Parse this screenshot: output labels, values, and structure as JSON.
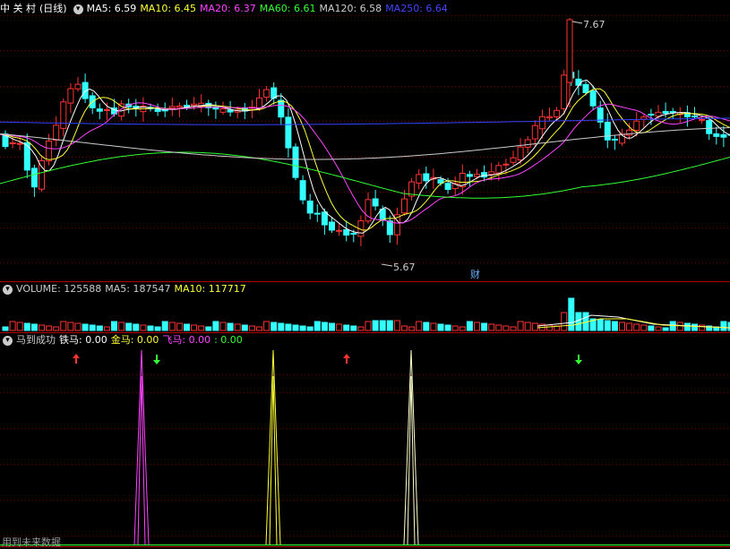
{
  "stock": {
    "name": "中 关 村",
    "period": "(日线)"
  },
  "main_ma": [
    {
      "label": "MA5: 6.59",
      "color": "#ffffff"
    },
    {
      "label": "MA10: 6.45",
      "color": "#ffff33"
    },
    {
      "label": "MA20: 6.37",
      "color": "#ff44ff"
    },
    {
      "label": "MA60: 6.61",
      "color": "#33ff33"
    },
    {
      "label": "MA120: 6.58",
      "color": "#cccccc"
    },
    {
      "label": "MA250: 6.64",
      "color": "#4444ff"
    }
  ],
  "price_high_label": "7.67",
  "price_low_label": "5.67",
  "cai_marker": "财",
  "volume": {
    "labels": [
      {
        "label": "VOLUME: 125588",
        "color": "#cccccc"
      },
      {
        "label": "MA5: 187547",
        "color": "#cccccc"
      },
      {
        "label": "MA10: 117717",
        "color": "#ffff33"
      }
    ]
  },
  "indicator": {
    "labels": [
      {
        "label": "马到成功",
        "color": "#cccccc"
      },
      {
        "label": "铁马: 0.00",
        "color": "#ffffff"
      },
      {
        "label": "金马: 0.00",
        "color": "#ffff33"
      },
      {
        "label": "飞马: 0.00",
        "color": "#ff44ff"
      },
      {
        "label": ": 0.00",
        "color": "#33ff33"
      }
    ]
  },
  "footer_text": "用到未来数据",
  "colors": {
    "up": "#ff3333",
    "down": "#33ffff",
    "grid": "#7a0000"
  }
}
